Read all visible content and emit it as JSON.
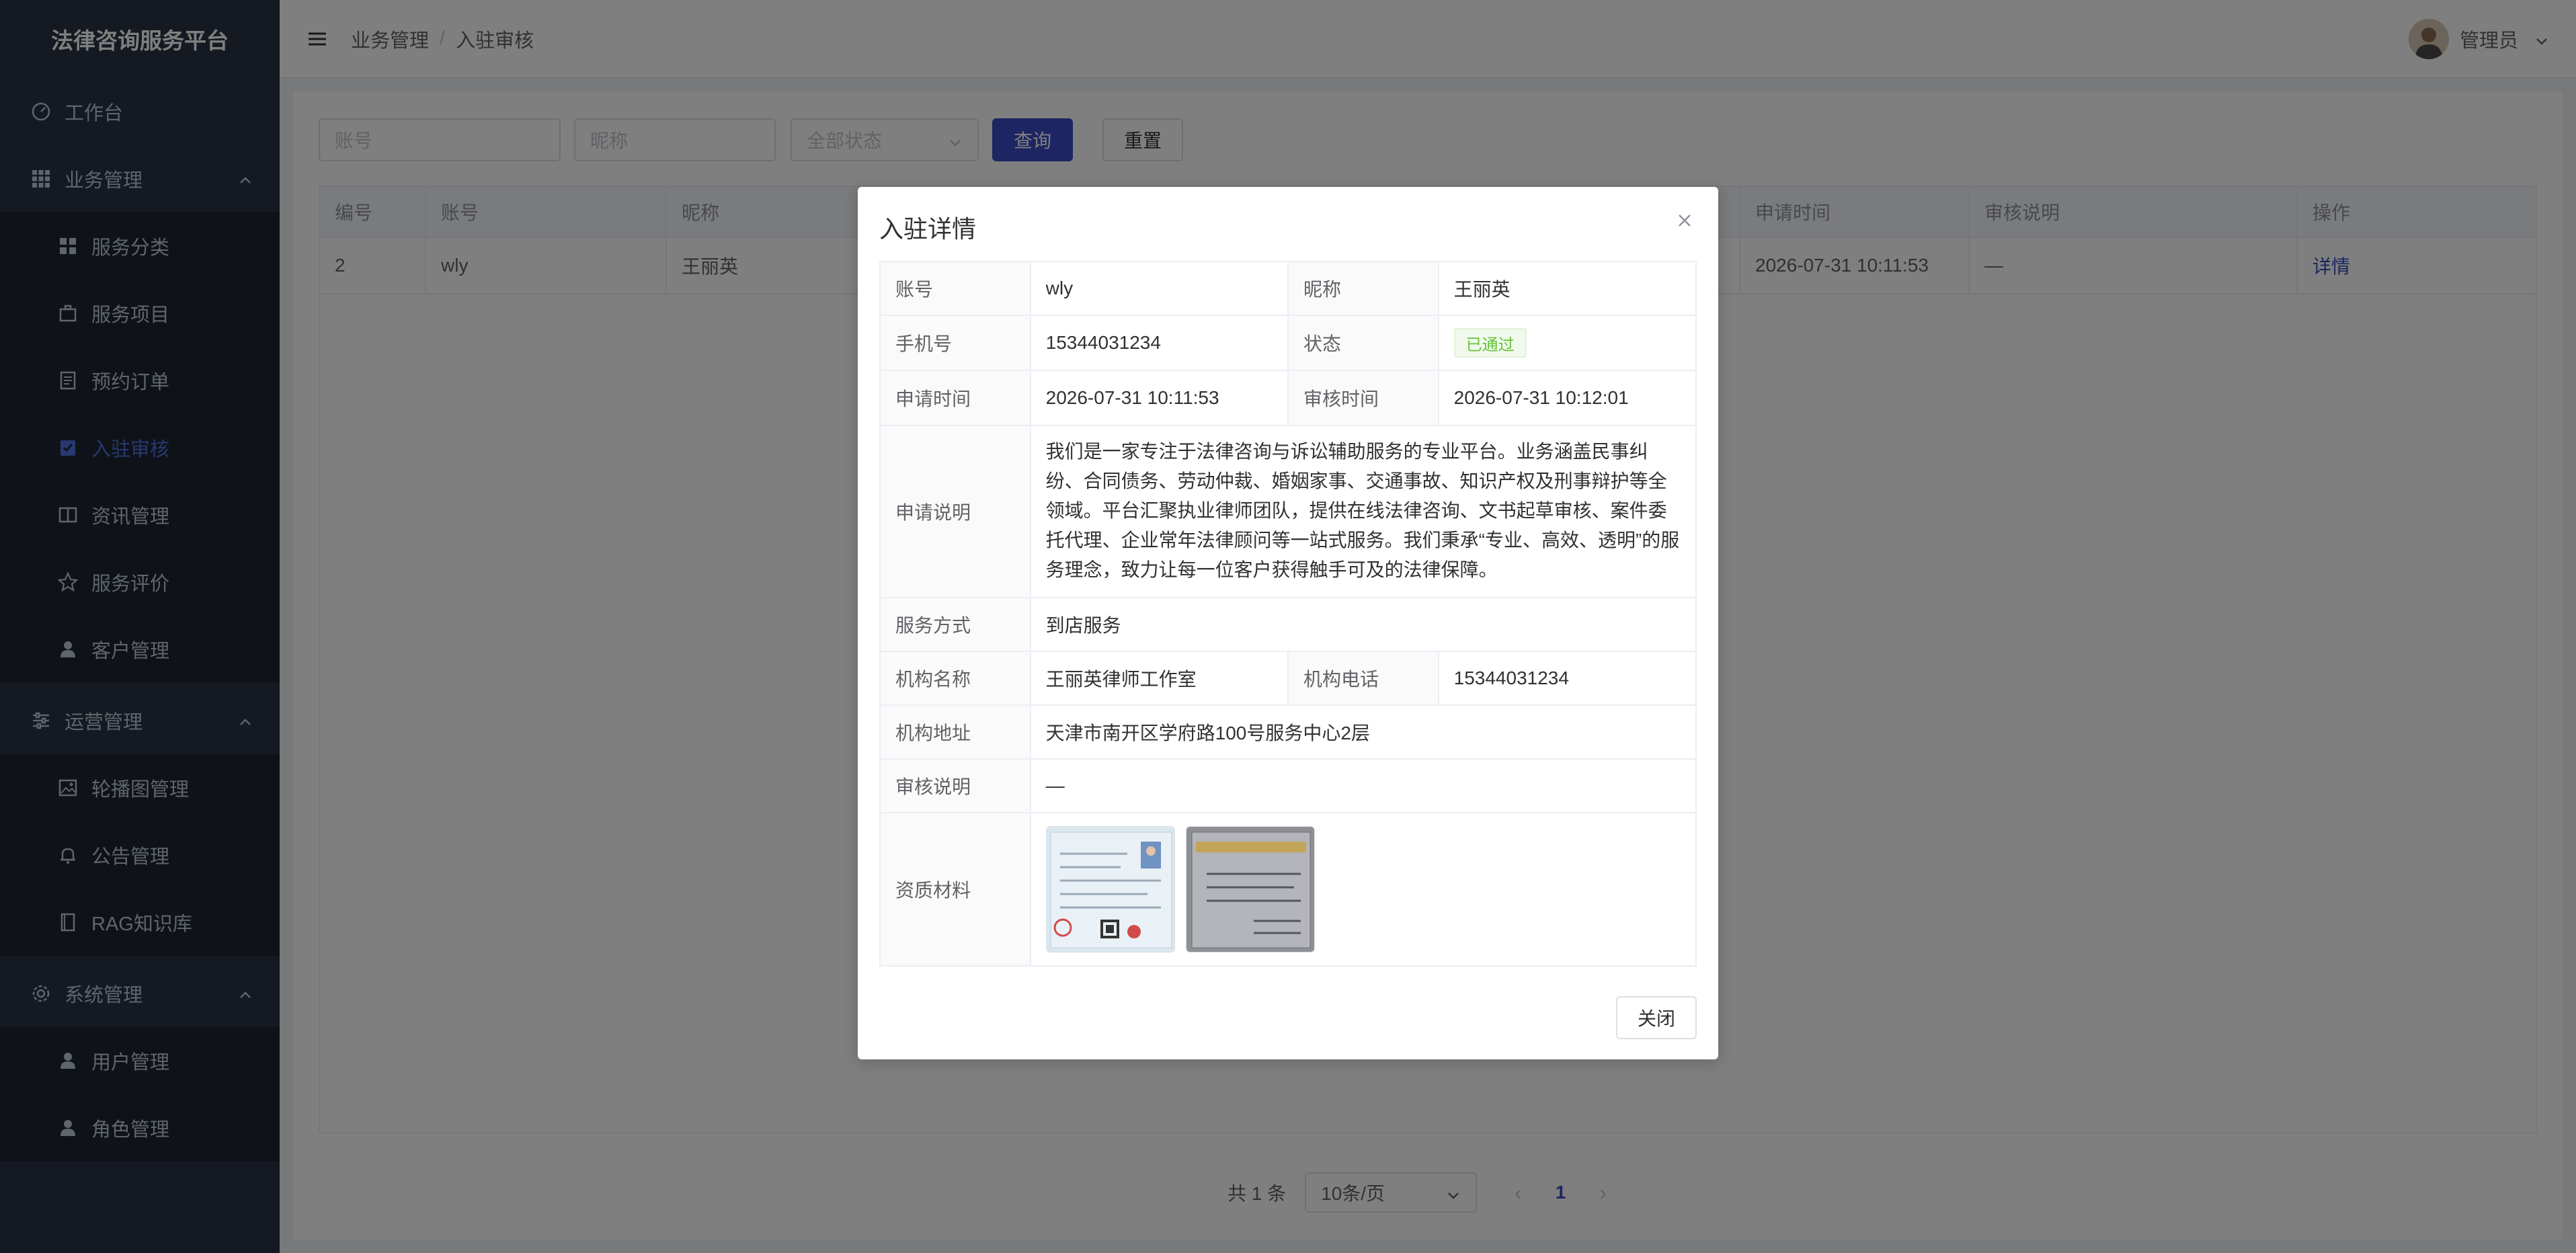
{
  "app": {
    "title": "法律咨询服务平台"
  },
  "sidebar": {
    "items": [
      {
        "label": "工作台",
        "icon": "dashboard-icon"
      },
      {
        "label": "业务管理",
        "icon": "grid-icon",
        "expanded": true
      },
      {
        "label": "服务分类",
        "icon": "category-icon"
      },
      {
        "label": "服务项目",
        "icon": "briefcase-icon"
      },
      {
        "label": "预约订单",
        "icon": "document-icon"
      },
      {
        "label": "入驻审核",
        "icon": "checklist-icon",
        "active": true
      },
      {
        "label": "资讯管理",
        "icon": "book-icon"
      },
      {
        "label": "服务评价",
        "icon": "star-icon"
      },
      {
        "label": "客户管理",
        "icon": "user-icon"
      },
      {
        "label": "运营管理",
        "icon": "sliders-icon",
        "expanded": true
      },
      {
        "label": "轮播图管理",
        "icon": "image-icon"
      },
      {
        "label": "公告管理",
        "icon": "bell-icon"
      },
      {
        "label": "RAG知识库",
        "icon": "book-icon"
      },
      {
        "label": "系统管理",
        "icon": "gear-icon",
        "expanded": true
      },
      {
        "label": "用户管理",
        "icon": "user-icon"
      },
      {
        "label": "角色管理",
        "icon": "user-icon"
      }
    ]
  },
  "header": {
    "breadcrumb": [
      "业务管理",
      "入驻审核"
    ],
    "separator": "/",
    "user": "管理员"
  },
  "filters": {
    "account_placeholder": "账号",
    "nickname_placeholder": "昵称",
    "status_value": "全部状态",
    "search_label": "查询",
    "reset_label": "重置"
  },
  "table": {
    "columns": [
      "编号",
      "账号",
      "昵称",
      "申请时间",
      "审核说明",
      "操作"
    ],
    "rows": [
      {
        "id": "2",
        "account": "wly",
        "nickname": "王丽英",
        "apply_time": "2026-07-31 10:11:53",
        "note": "—",
        "action": "详情"
      }
    ]
  },
  "pager": {
    "total": "共 1 条",
    "page_size": "10条/页",
    "current_page": "1",
    "prev": "‹",
    "next": "›"
  },
  "dialog": {
    "title": "入驻详情",
    "close_label": "关闭",
    "labels": {
      "account": "账号",
      "nickname": "昵称",
      "phone": "手机号",
      "status": "状态",
      "apply_time": "申请时间",
      "review_time": "审核时间",
      "apply_desc": "申请说明",
      "service_mode": "服务方式",
      "org_name": "机构名称",
      "org_phone": "机构电话",
      "org_address": "机构地址",
      "review_note": "审核说明",
      "materials": "资质材料"
    },
    "values": {
      "account": "wly",
      "nickname": "王丽英",
      "phone": "15344031234",
      "status": "已通过",
      "apply_time": "2026-07-31 10:11:53",
      "review_time": "2026-07-31 10:12:01",
      "apply_desc": "我们是一家专注于法律咨询与诉讼辅助服务的专业平台。业务涵盖民事纠纷、合同债务、劳动仲裁、婚姻家事、交通事故、知识产权及刑事辩护等全领域。平台汇聚执业律师团队，提供在线法律咨询、文书起草审核、案件委托代理、企业常年法律顾问等一站式服务。我们秉承“专业、高效、透明”的服务理念，致力让每一位客户获得触手可及的法律保障。",
      "service_mode": "到店服务",
      "org_name": "王丽英律师工作室",
      "org_phone": "15344031234",
      "org_address": "天津市南开区学府路100号服务中心2层",
      "review_note": "—"
    },
    "colors": {
      "status_green": "#67c23a",
      "primary": "#3a4cc4"
    }
  }
}
